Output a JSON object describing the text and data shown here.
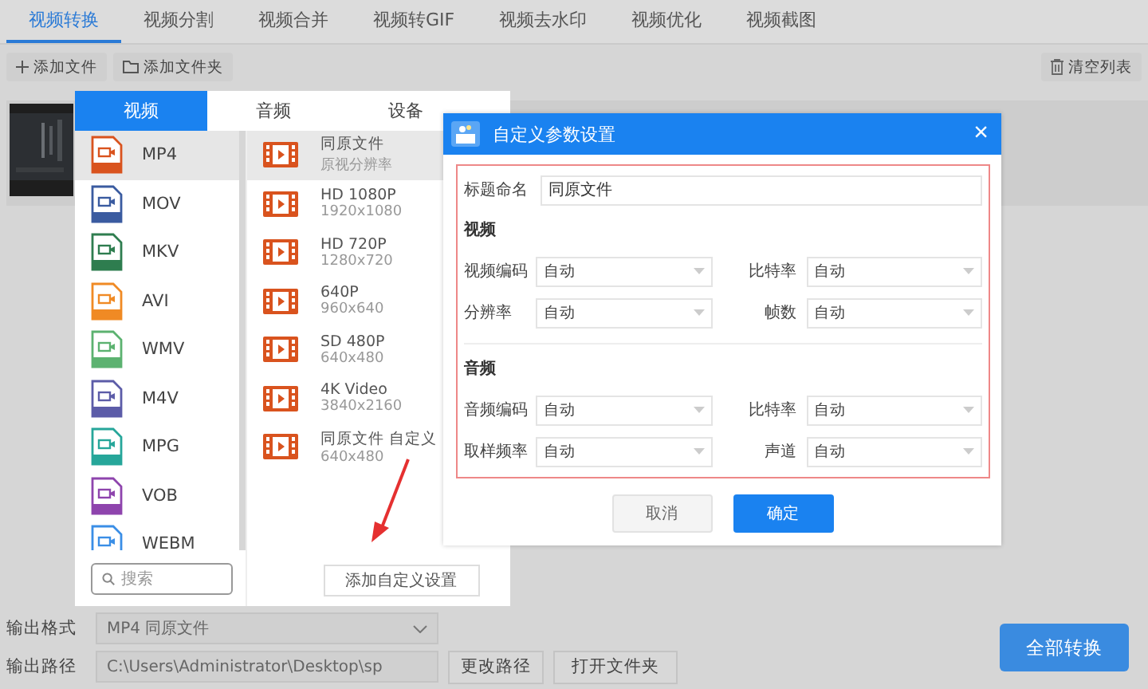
{
  "tabs": [
    {
      "label": "视频转换",
      "selected": true
    },
    {
      "label": "视频分割",
      "selected": false
    },
    {
      "label": "视频合并",
      "selected": false
    },
    {
      "label": "视频转GIF",
      "selected": false
    },
    {
      "label": "视频去水印",
      "selected": false
    },
    {
      "label": "视频优化",
      "selected": false
    },
    {
      "label": "视频截图",
      "selected": false
    }
  ],
  "toolbar": {
    "add_file": "添加文件",
    "add_folder": "添加文件夹",
    "clear_list": "清空列表"
  },
  "format_popup": {
    "tabs": [
      {
        "label": "视频",
        "selected": true
      },
      {
        "label": "音频",
        "selected": false
      },
      {
        "label": "设备",
        "selected": false
      }
    ],
    "formats": [
      {
        "label": "MP4",
        "color": "#d9531e",
        "selected": true
      },
      {
        "label": "MOV",
        "color": "#3a5ba0",
        "selected": false
      },
      {
        "label": "MKV",
        "color": "#2e7d4f",
        "selected": false
      },
      {
        "label": "AVI",
        "color": "#f08a24",
        "selected": false
      },
      {
        "label": "WMV",
        "color": "#5cb270",
        "selected": false
      },
      {
        "label": "M4V",
        "color": "#5c5ca8",
        "selected": false
      },
      {
        "label": "MPG",
        "color": "#26a69a",
        "selected": false
      },
      {
        "label": "VOB",
        "color": "#8e44ad",
        "selected": false
      },
      {
        "label": "WEBM",
        "color": "#3a8ee6",
        "selected": false
      }
    ],
    "presets": [
      {
        "title": "同原文件",
        "subtitle": "原视分辨率",
        "selected": true
      },
      {
        "title": "HD 1080P",
        "subtitle": "1920x1080",
        "selected": false
      },
      {
        "title": "HD 720P",
        "subtitle": "1280x720",
        "selected": false
      },
      {
        "title": "640P",
        "subtitle": "960x640",
        "selected": false
      },
      {
        "title": "SD 480P",
        "subtitle": "640x480",
        "selected": false
      },
      {
        "title": "4K Video",
        "subtitle": "3840x2160",
        "selected": false
      },
      {
        "title": "同原文件 自定义",
        "subtitle": "640x480",
        "selected": false
      }
    ],
    "search": {
      "placeholder": "搜索"
    },
    "add_custom": "添加自定义设置"
  },
  "dialog": {
    "title": "自定义参数设置",
    "close": "×",
    "title_field": {
      "label": "标题命名",
      "value": "同原文件"
    },
    "sections": [
      {
        "heading": "视频",
        "fields": [
          {
            "label": "视频编码",
            "value": "自动"
          },
          {
            "label": "比特率",
            "value": "自动"
          },
          {
            "label": "分辨率",
            "value": "自动"
          },
          {
            "label": "帧数",
            "value": "自动"
          }
        ]
      },
      {
        "heading": "音频",
        "fields": [
          {
            "label": "音频编码",
            "value": "自动"
          },
          {
            "label": "比特率",
            "value": "自动"
          },
          {
            "label": "取样频率",
            "value": "自动"
          },
          {
            "label": "声道",
            "value": "自动"
          }
        ]
      }
    ],
    "cancel": "取消",
    "ok": "确定"
  },
  "output": {
    "format_label": "输出格式",
    "format_value": "MP4  同原文件",
    "path_label": "输出路径",
    "path_value": "C:\\Users\\Administrator\\Desktop\\sp",
    "change_path": "更改路径",
    "open_folder": "打开文件夹",
    "convert_all": "全部转换"
  }
}
